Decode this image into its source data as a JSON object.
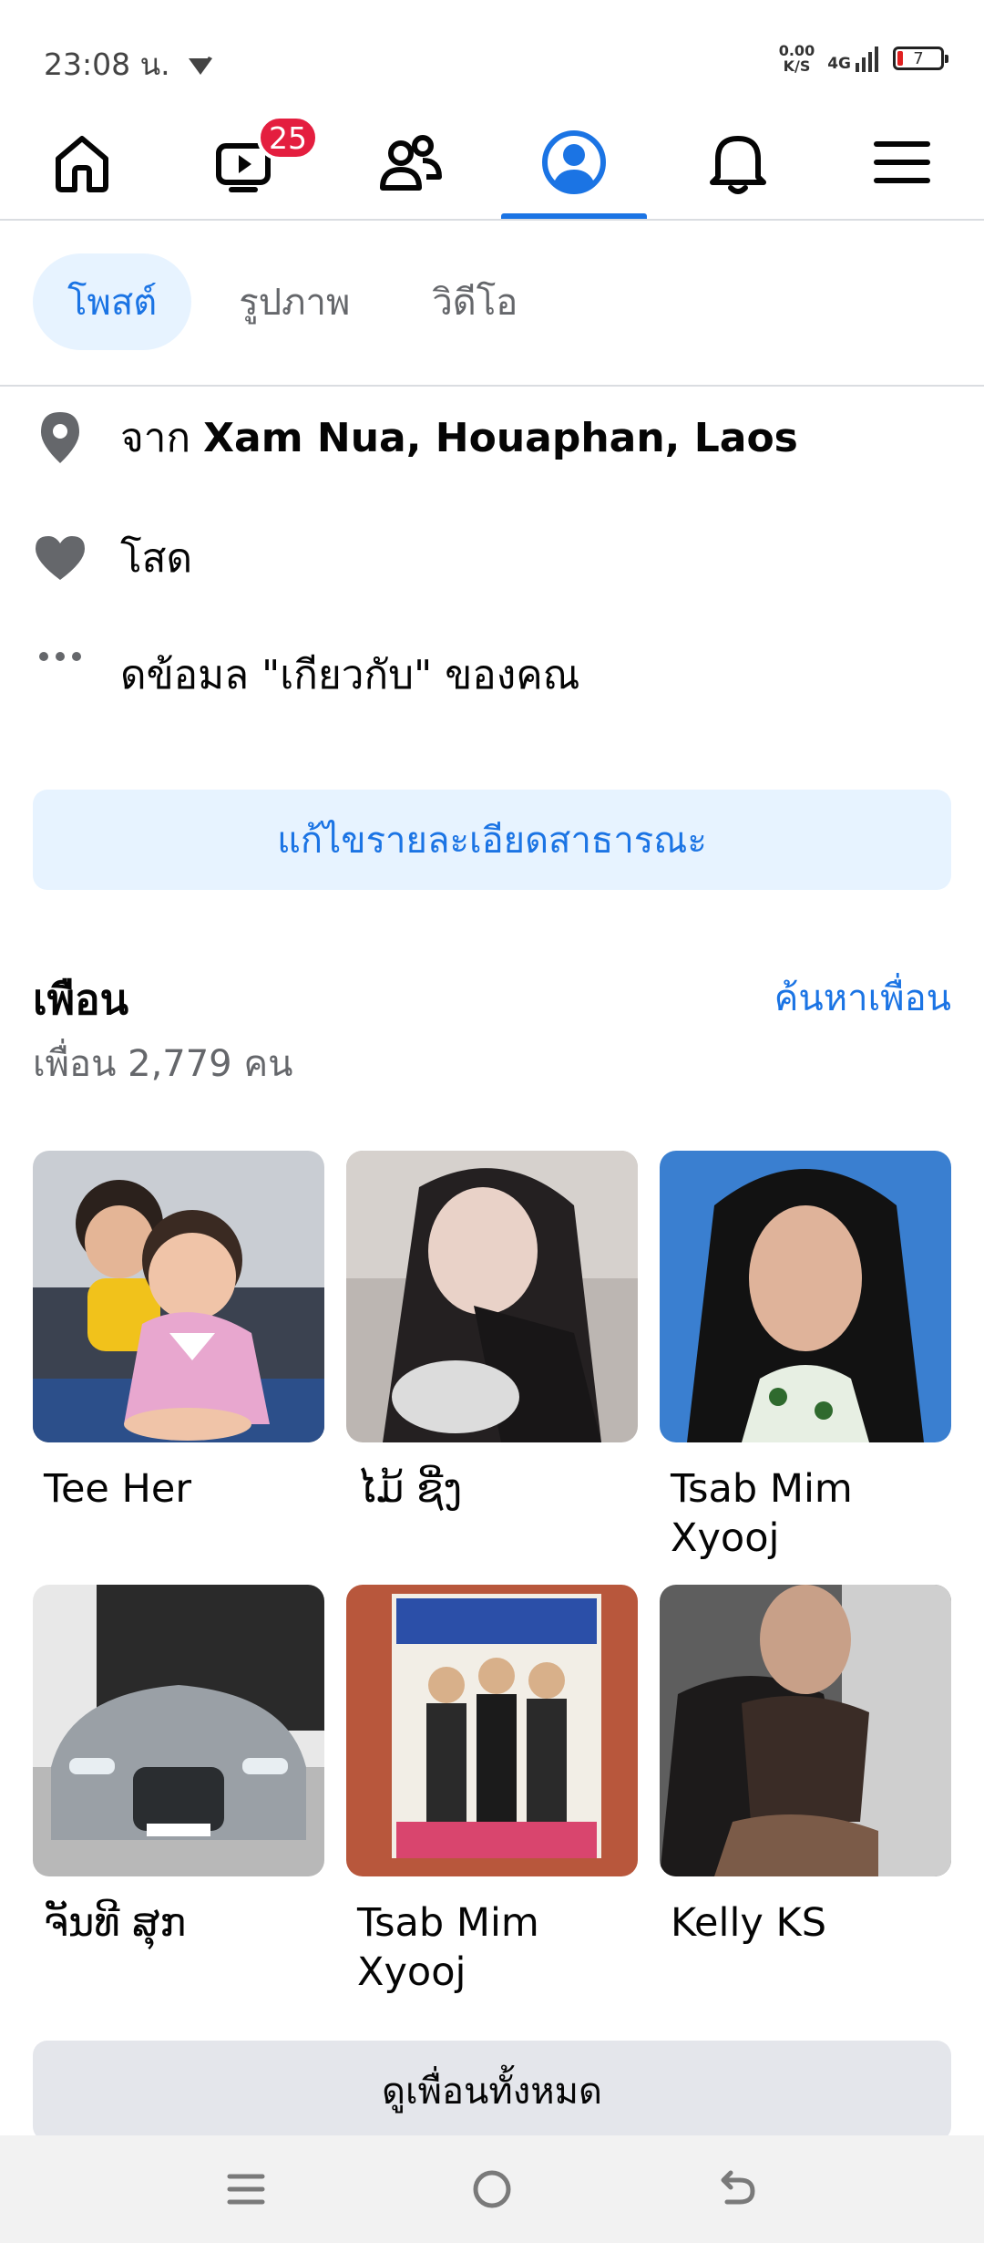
{
  "status_bar": {
    "time": "23:08 น.",
    "net_speed_value": "0.00",
    "net_speed_unit": "K/S",
    "network": "4G",
    "battery": "7"
  },
  "nav": {
    "notification_badge": "25"
  },
  "tabs": [
    {
      "label": "โพสต์"
    },
    {
      "label": "รูปภาพ"
    },
    {
      "label": "วิดีโอ"
    }
  ],
  "info": {
    "location_prefix": "จาก ",
    "location_place": "Xam Nua, Houaphan, Laos",
    "relationship": "โสด",
    "about": "ดข้อมล \"เกียวกับ\" ของคณ"
  },
  "edit_details_label": "แก้ไขรายละเอียดสาธารณะ",
  "friends": {
    "title": "เพือน",
    "count_text": "เพื่อน 2,779 คน",
    "find_label": "ค้นหาเพื่อน",
    "list": [
      {
        "name": "Tee Her"
      },
      {
        "name": "ໄມ້ ຊີ່ງ"
      },
      {
        "name": "Tsab Mim Xyooj"
      },
      {
        "name": "ຈັນທີ ສຸກ"
      },
      {
        "name": "Tsab Mim Xyooj"
      },
      {
        "name": "Kelly KS"
      }
    ],
    "see_all_label": "ดูเพื่อนทั้งหมด"
  },
  "colors": {
    "accent": "#1b74e4",
    "accent_bg": "#e7f3ff",
    "badge": "#e41e3f"
  },
  "icons": [
    "home-icon",
    "video-icon",
    "friends-icon",
    "profile-icon",
    "bell-icon",
    "menu-icon",
    "location-pin-icon",
    "heart-icon",
    "more-dots-icon"
  ]
}
